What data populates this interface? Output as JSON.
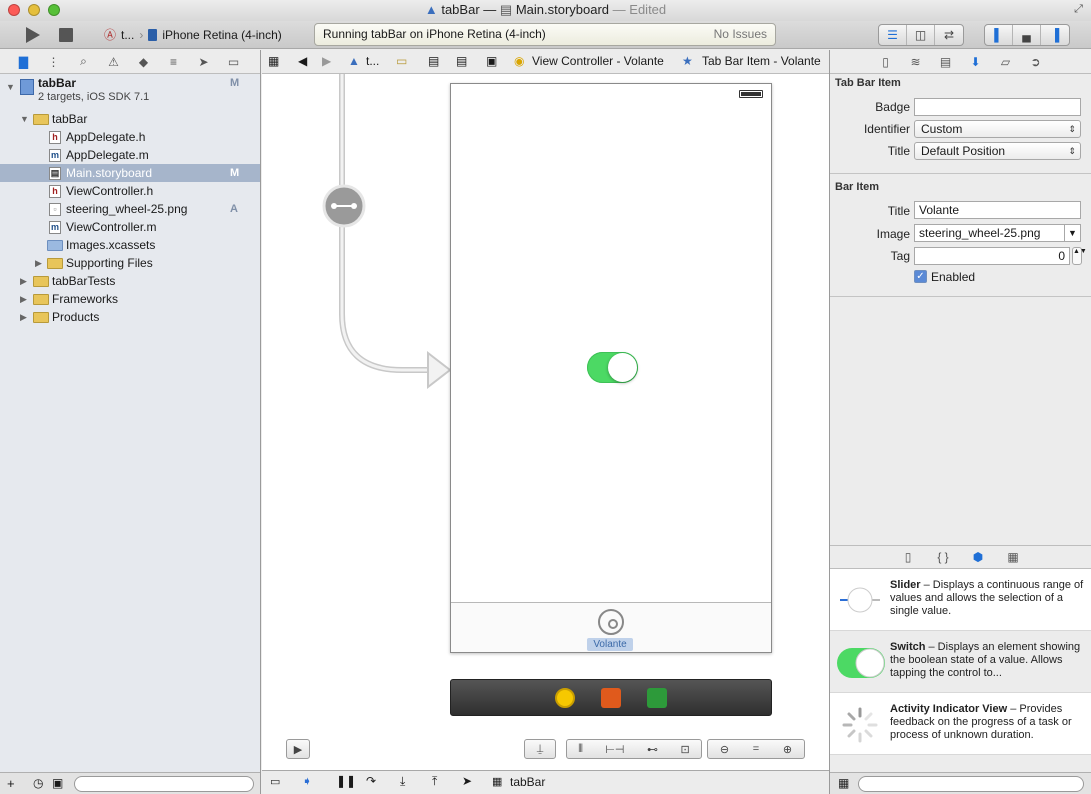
{
  "window": {
    "title_project": "tabBar",
    "title_sep": "—",
    "title_file": "Main.storyboard",
    "title_state": "— Edited"
  },
  "toolbar": {
    "scheme_target": "t...",
    "scheme_device": "iPhone Retina (4-inch)",
    "status_text": "Running tabBar on iPhone Retina (4-inch)",
    "issues_text": "No Issues"
  },
  "navigator": {
    "project_name": "tabBar",
    "project_subtitle": "2 targets, iOS SDK 7.1",
    "project_badge": "M",
    "items": [
      {
        "label": "tabBar"
      },
      {
        "label": "AppDelegate.h"
      },
      {
        "label": "AppDelegate.m"
      },
      {
        "label": "Main.storyboard",
        "badge": "M"
      },
      {
        "label": "ViewController.h"
      },
      {
        "label": "steering_wheel-25.png",
        "badge": "A"
      },
      {
        "label": "ViewController.m"
      },
      {
        "label": "Images.xcassets"
      },
      {
        "label": "Supporting Files"
      },
      {
        "label": "tabBarTests"
      },
      {
        "label": "Frameworks"
      },
      {
        "label": "Products"
      }
    ]
  },
  "jumpbar": {
    "c1": "t...",
    "c_vc": "View Controller - Volante",
    "c_item": "Tab Bar Item - Volante"
  },
  "scene": {
    "tab_label": "Volante",
    "switch_on": true
  },
  "debugbar": {
    "target": "tabBar"
  },
  "inspector": {
    "tab_bar_item_header": "Tab Bar Item",
    "badge_label": "Badge",
    "badge_value": "",
    "identifier_label": "Identifier",
    "identifier_value": "Custom",
    "title_label": "Title",
    "title_value": "Default Position",
    "bar_item_header": "Bar Item",
    "bar_title_label": "Title",
    "bar_title_value": "Volante",
    "image_label": "Image",
    "image_value": "steering_wheel-25.png",
    "tag_label": "Tag",
    "tag_value": "0",
    "enabled_label": "Enabled",
    "enabled": true
  },
  "library": {
    "items": [
      {
        "name": "Slider",
        "desc": " – Displays a continuous range of values and allows the selection of a single value."
      },
      {
        "name": "Switch",
        "desc": " – Displays an element showing the boolean state of a value. Allows tapping the control to..."
      },
      {
        "name": "Activity Indicator View",
        "desc": " – Provides feedback on the progress of a task or process of unknown duration."
      }
    ]
  }
}
